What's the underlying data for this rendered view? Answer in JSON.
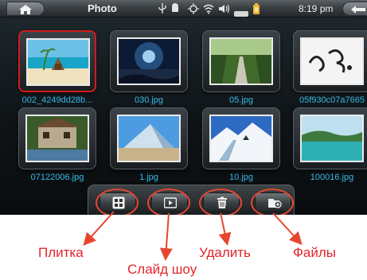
{
  "statusbar": {
    "title": "Photo",
    "time": "8:19 pm",
    "icons": [
      "home-icon",
      "usb-icon",
      "android-icon",
      "brightness-icon",
      "wifi-icon",
      "volume-icon",
      "battery-icon",
      "back-icon"
    ]
  },
  "gallery": {
    "items": [
      {
        "caption": "002_4249dd28b...",
        "selected": true
      },
      {
        "caption": "030.jpg"
      },
      {
        "caption": "05.jpg"
      },
      {
        "caption": "05f930c07a7665"
      },
      {
        "caption": "07122006.jpg"
      },
      {
        "caption": "1.jpg"
      },
      {
        "caption": "10.jpg"
      },
      {
        "caption": "100016.jpg"
      }
    ]
  },
  "toolbar": {
    "buttons": [
      "tile-view-icon",
      "slideshow-icon",
      "delete-icon",
      "files-icon"
    ]
  },
  "annotations": {
    "tile": "Плитка",
    "slideshow": "Слайд шоу",
    "delete": "Удалить",
    "files": "Файлы"
  },
  "colors": {
    "caption": "#35b9e6",
    "selected_border": "#d11c1c",
    "annotation": "#e3242b"
  }
}
